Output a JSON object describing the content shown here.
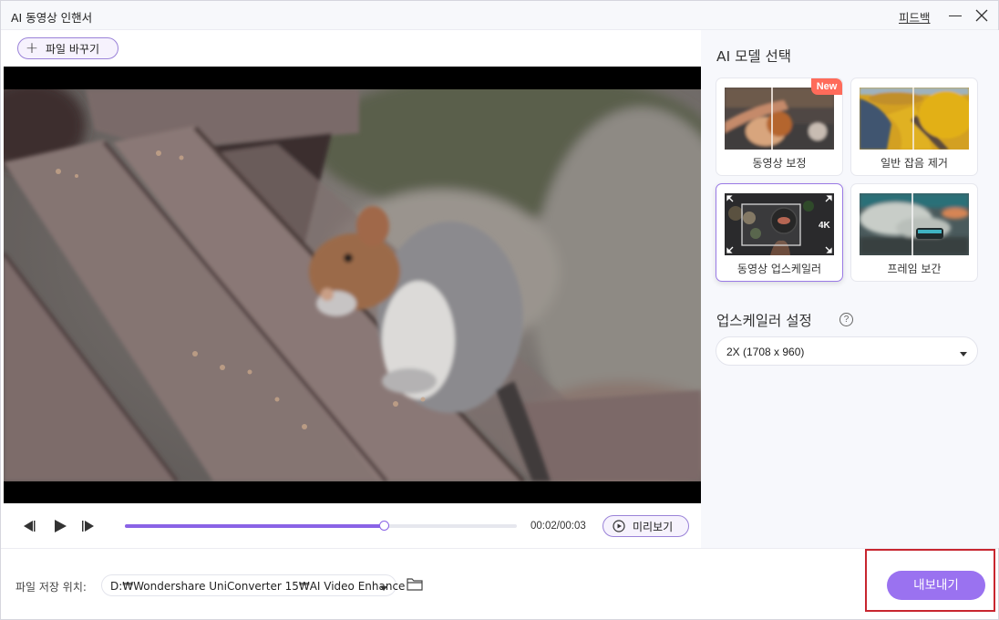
{
  "window": {
    "title": "AI 동영상 인핸서",
    "feedback_label": "피드백",
    "minimize_icon": "minimize-icon",
    "close_icon": "close-icon"
  },
  "toolbar": {
    "replace_file_label": "파일 바꾸기",
    "replace_file_icon": "plus-icon"
  },
  "player": {
    "current_time": "00:02",
    "total_time": "00:03",
    "time_display": "00:02/00:03",
    "progress_fraction": 0.66,
    "preview_label": "미리보기",
    "icons": [
      "previous-frame-icon",
      "play-icon",
      "next-frame-icon",
      "preview-play-icon"
    ]
  },
  "right_panel": {
    "model_section_title": "AI 모델 선택",
    "models": [
      {
        "label": "동영상 보정",
        "badge": "New",
        "selected": false
      },
      {
        "label": "일반 잡음 제거",
        "badge": null,
        "selected": false
      },
      {
        "label": "동영상 업스케일러",
        "badge": null,
        "selected": true,
        "thumb_text": "4K"
      },
      {
        "label": "프레임 보간",
        "badge": null,
        "selected": false
      }
    ],
    "upscale_section_title": "업스케일러 설정",
    "help_icon_glyph": "?",
    "resolution_value": "2X (1708 x 960)"
  },
  "bottom": {
    "save_location_label": "파일 저장 위치:",
    "save_path": "D:₩Wondershare UniConverter 15₩AI Video Enhance",
    "export_label": "내보내기"
  },
  "colors": {
    "accent": "#8a63e6",
    "export_button": "#9a72f0",
    "new_badge": "#ff6b5a",
    "highlight_border": "#c8262f"
  }
}
